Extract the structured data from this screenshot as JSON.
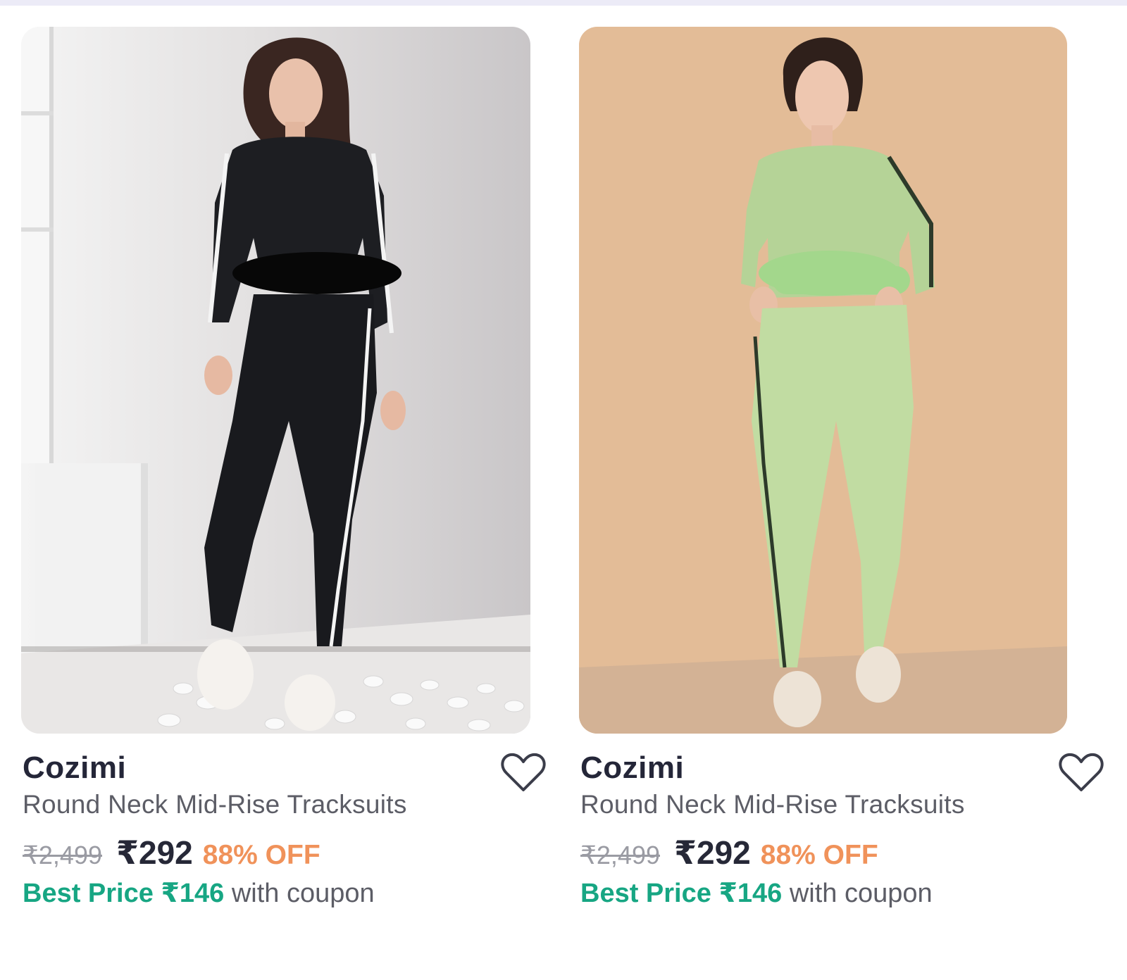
{
  "products": [
    {
      "brand": "Cozimi",
      "title": "Round Neck Mid-Rise Tracksuits",
      "mrp": "₹2,499",
      "price": "₹292",
      "discount": "88% OFF",
      "best_price_label": "Best Price ₹146",
      "best_price_suffix": " with coupon",
      "wishlist_icon": "heart-outline-icon",
      "image_alt": "Model wearing black round neck tracksuit with white side stripes"
    },
    {
      "brand": "Cozimi",
      "title": "Round Neck Mid-Rise Tracksuits",
      "mrp": "₹2,499",
      "price": "₹292",
      "discount": "88% OFF",
      "best_price_label": "Best Price ₹146",
      "best_price_suffix": " with coupon",
      "wishlist_icon": "heart-outline-icon",
      "image_alt": "Model wearing light green round neck tracksuit with dark side stripes"
    }
  ],
  "colors": {
    "brand_text": "#242638",
    "discount": "#f0925a",
    "best_price": "#17a683",
    "strike": "#9a9ba3"
  }
}
